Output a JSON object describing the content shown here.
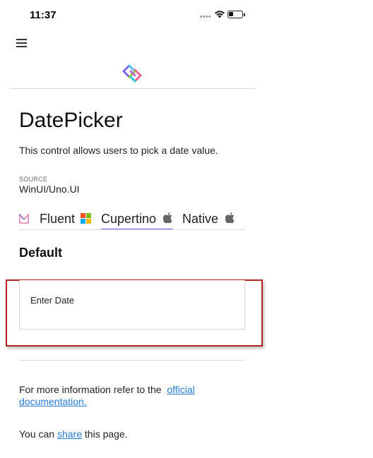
{
  "status_bar": {
    "time": "11:37",
    "icons": [
      "signal-dots-icon",
      "wifi-icon",
      "battery-icon"
    ]
  },
  "header": {
    "menu_icon": "hamburger-menu-icon",
    "logo_icon": "uno-platform-logo-icon"
  },
  "page": {
    "title": "DatePicker",
    "description": "This control allows users to pick a date value.",
    "source_label": "SOURCE",
    "source_value": "WinUI/Uno.UI"
  },
  "tabs": [
    {
      "label": "Fluent",
      "icon": "windows-logo-icon",
      "selected": false
    },
    {
      "label": "Cupertino",
      "icon": "apple-logo-icon",
      "selected": true
    },
    {
      "label": "Native",
      "icon": "apple-logo-icon",
      "selected": false
    }
  ],
  "tabs_leading_icon": "material-m-logo-icon",
  "section": {
    "title": "Default",
    "date_picker": {
      "placeholder": "Enter Date"
    }
  },
  "footer": {
    "info_prefix": "For more information refer to the  ",
    "info_link_1": "official",
    "info_link_2": "documentation.",
    "share_prefix": "You can ",
    "share_link": "share",
    "share_suffix": " this page."
  },
  "colors": {
    "accent_underline": "#6a5cf0",
    "link": "#2a7bd6",
    "highlight_border": "#b22222",
    "divider": "#dadada"
  }
}
